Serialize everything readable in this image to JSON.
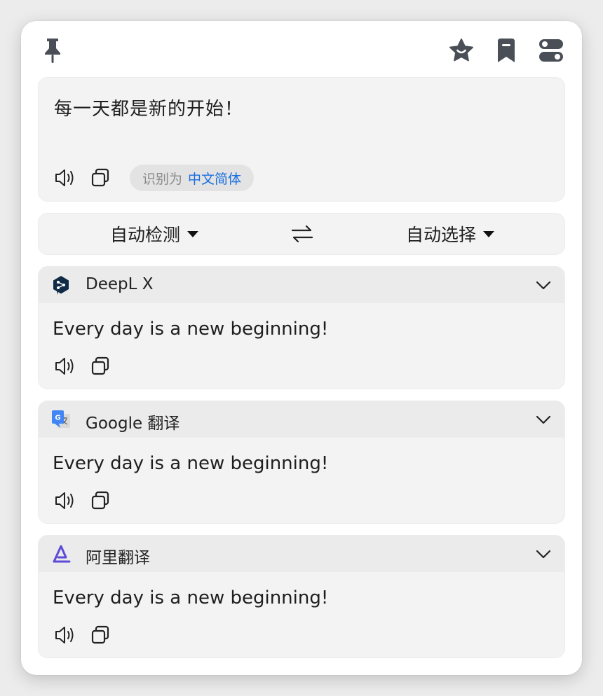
{
  "source": {
    "text": "每一天都是新的开始！",
    "detected_label": "识别为",
    "detected_lang": "中文简体"
  },
  "languages": {
    "from": "自动检测",
    "to": "自动选择"
  },
  "results": [
    {
      "service": "DeepL X",
      "text": "Every day is a new beginning!"
    },
    {
      "service": "Google 翻译",
      "text": "Every day is a new beginning!"
    },
    {
      "service": "阿里翻译",
      "text": "Every day is a new beginning!"
    }
  ],
  "colors": {
    "accent": "#1a6fe0",
    "icon": "#4a4f57",
    "panel": "#f3f3f3",
    "panel_header": "#ebebeb"
  },
  "icons": [
    "pin-icon",
    "star-icon",
    "bookmark-icon",
    "toggle-settings-icon",
    "speaker-icon",
    "copy-icon",
    "swap-icon",
    "chevron-down-icon",
    "deepl-logo",
    "google-translate-logo",
    "alibaba-translate-logo"
  ]
}
